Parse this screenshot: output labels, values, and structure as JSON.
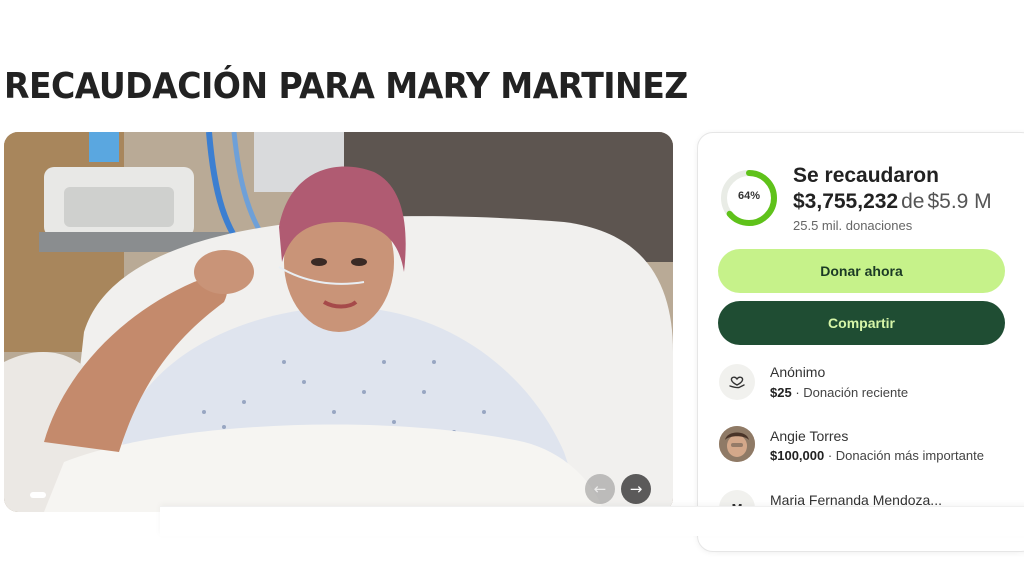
{
  "page": {
    "title": "RECAUDACIÓN PARA MARY MARTINEZ"
  },
  "carousel": {
    "prev_icon": "arrow-left-icon",
    "next_icon": "arrow-right-icon",
    "prev_glyph": "←",
    "next_glyph": "→"
  },
  "summary": {
    "progress_percent": 64,
    "progress_label": "64%",
    "raised_label": "Se recaudaron",
    "raised_amount": "$3,755,232",
    "of_text": "de",
    "goal": "$5.9 M",
    "donation_count": "25.5 mil. donaciones"
  },
  "actions": {
    "donate_label": "Donar ahora",
    "share_label": "Compartir"
  },
  "donors": [
    {
      "name": "Anónimo",
      "amount": "$25",
      "separator": " · ",
      "detail": "Donación reciente",
      "avatar": "heart-hand-icon"
    },
    {
      "name": "Angie Torres",
      "amount": "$100,000",
      "separator": " · ",
      "detail": "Donación más importante",
      "avatar": "user-photo"
    },
    {
      "name": "Maria Fernanda Mendoza...",
      "avatar_initial": "M"
    }
  ],
  "colors": {
    "accent_light": "#c6f28a",
    "accent_dark": "#1f4d33",
    "progress": "#5fc21a"
  }
}
